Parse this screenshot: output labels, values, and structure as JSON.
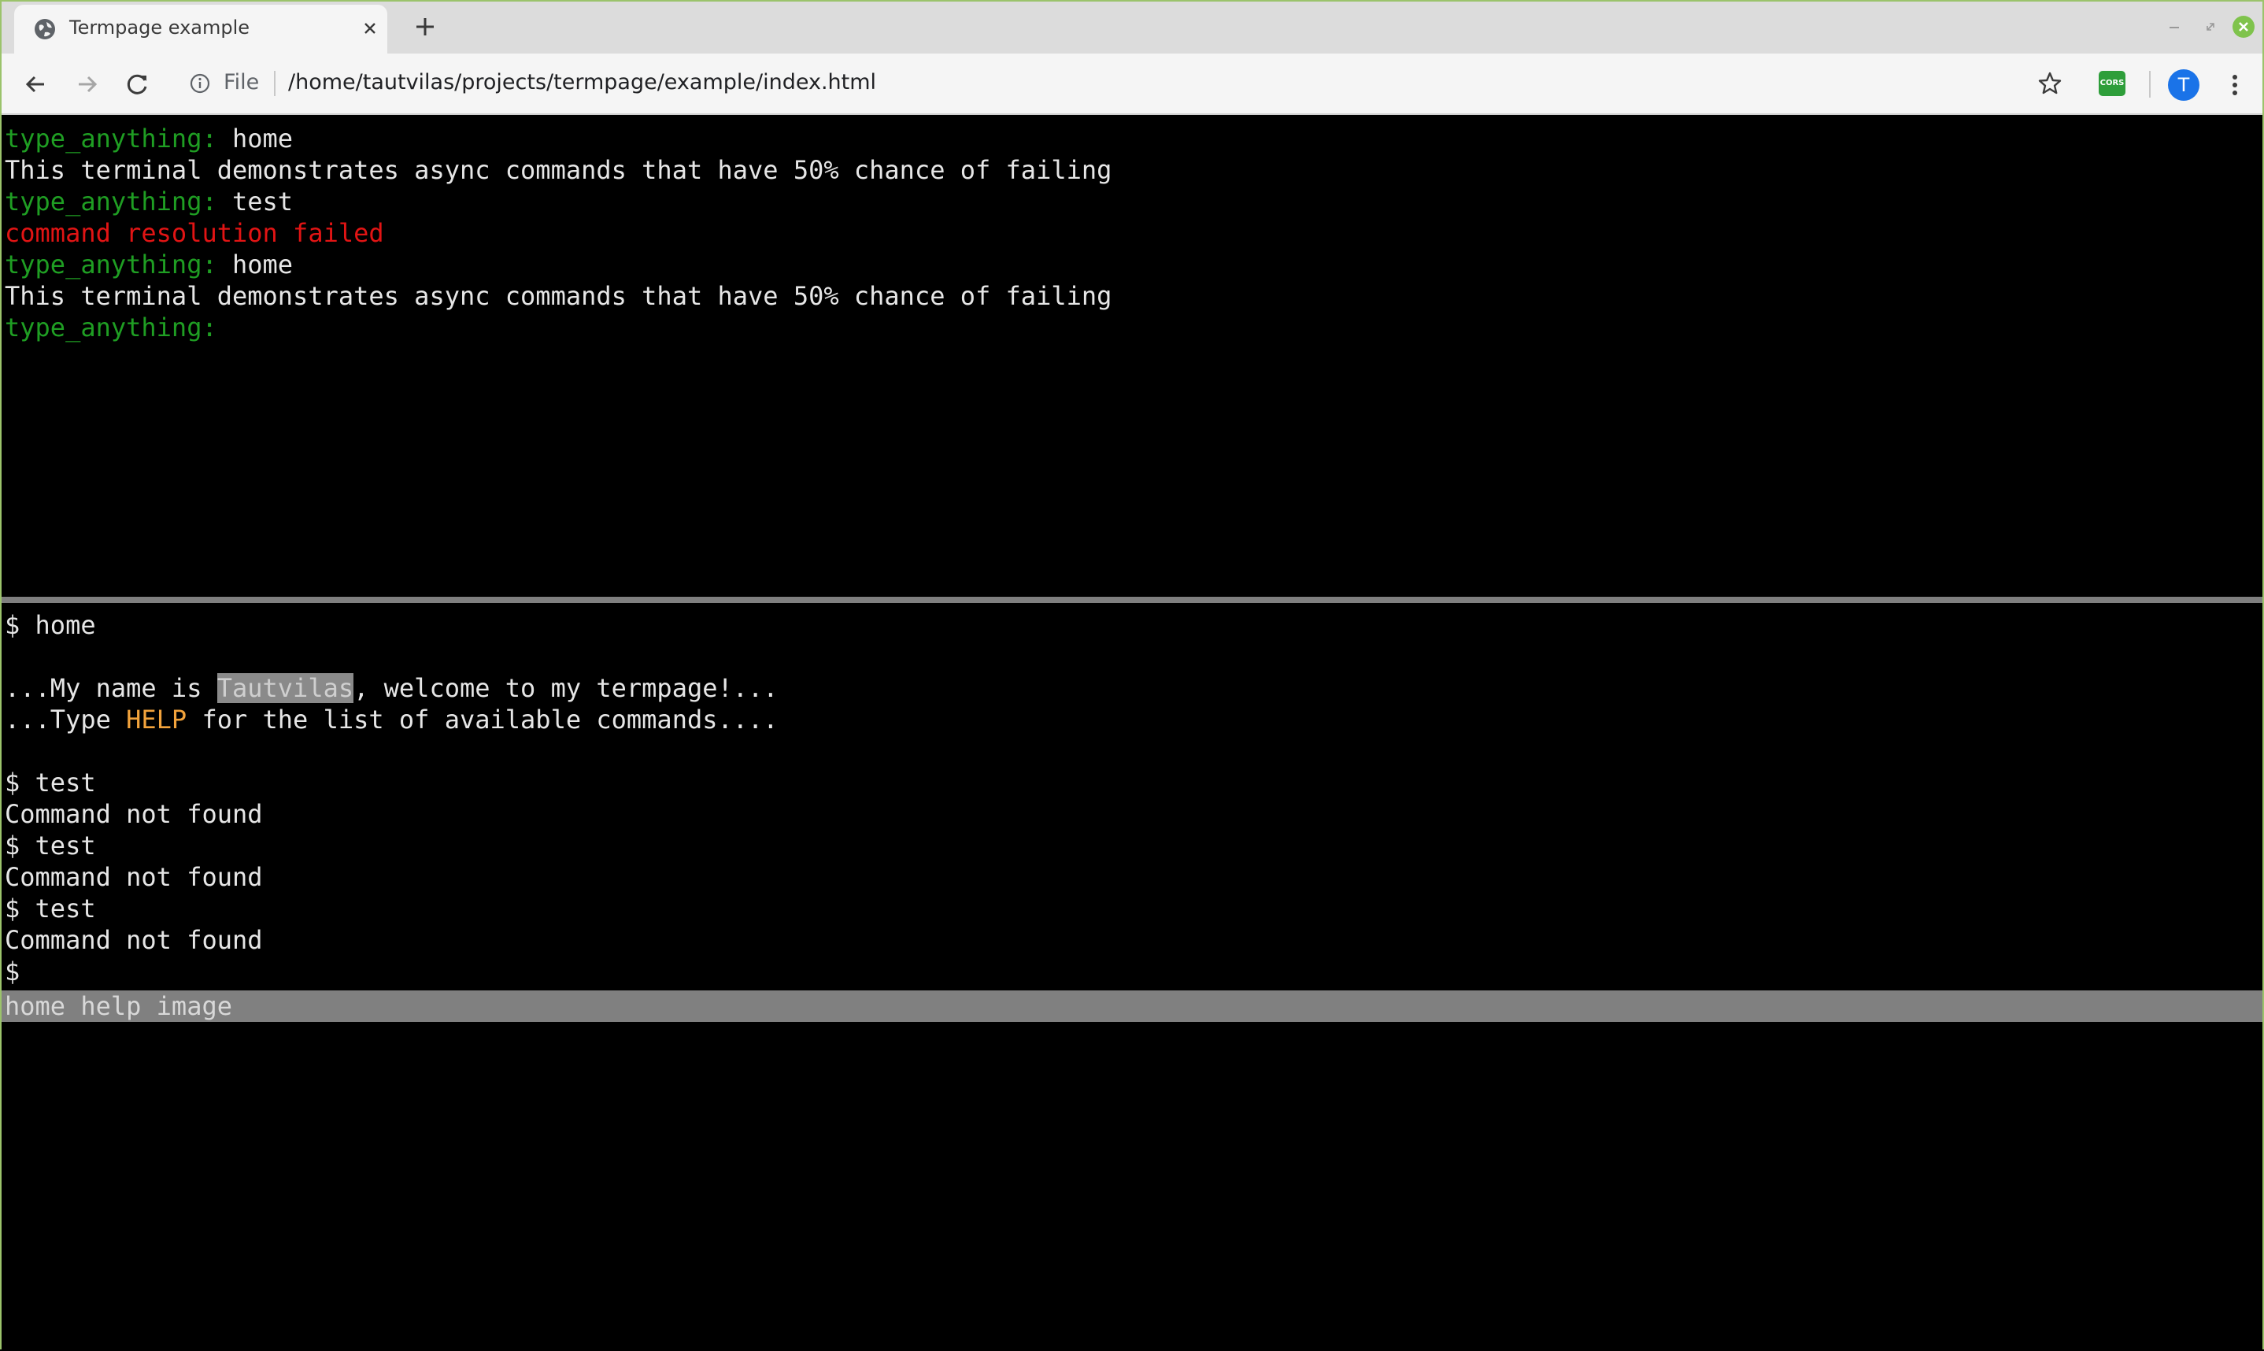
{
  "browser": {
    "tab_title": "Termpage example",
    "new_tab_symbol": "+",
    "scheme_label": "File",
    "url": "/home/tautvilas/projects/termpage/example/index.html",
    "extension_label": "CORS",
    "avatar_initial": "T",
    "accent_color": "#9bc36b"
  },
  "top_terminal": {
    "prompt_label": "type_anything:",
    "lines": [
      {
        "prompt": "type_anything:",
        "input": " home"
      },
      {
        "output": "This terminal demonstrates async commands that have 50% chance of failing"
      },
      {
        "prompt": "type_anything:",
        "input": " test"
      },
      {
        "error": "command resolution failed"
      },
      {
        "prompt": "type_anything:",
        "input": " home"
      },
      {
        "output": "This terminal demonstrates async commands that have 50% chance of failing"
      },
      {
        "prompt": "type_anything:",
        "input": ""
      }
    ]
  },
  "bottom_terminal": {
    "prompt_symbol": "$",
    "cmd_home": " home",
    "welcome_prefix": "...My name is ",
    "welcome_name": "Tautvilas",
    "welcome_suffix": ", welcome to my termpage!...",
    "help_prefix": "...Type ",
    "help_keyword": "HELP",
    "help_suffix": " for the list of available commands....",
    "cmd_test": " test",
    "not_found": "Command not found",
    "suggestions": "home help image"
  }
}
